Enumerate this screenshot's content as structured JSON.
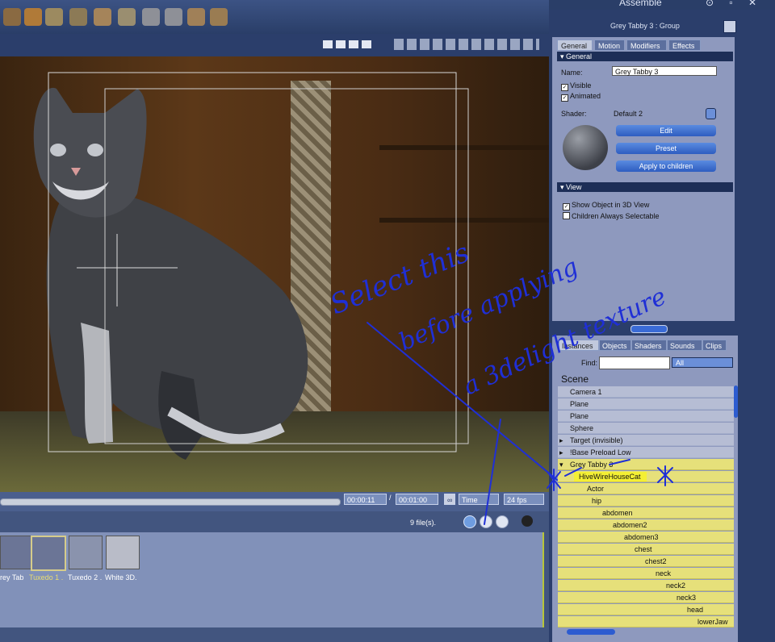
{
  "toolbar": {
    "mode_label": "Assemble",
    "window_controls": "⊙ ▫ ✕"
  },
  "viewport": {
    "subject": "cat figure"
  },
  "timeline": {
    "current_time": "00:00:11",
    "separator": "/",
    "total_time": "00:01:00",
    "time_mode": "Time",
    "fps": "24 fps"
  },
  "library": {
    "file_count": "9 file(s).",
    "items": [
      {
        "label": "rey Tab"
      },
      {
        "label": "Tuxedo 1 ."
      },
      {
        "label": "Tuxedo 2 ."
      },
      {
        "label": "White 3D."
      }
    ],
    "selected_color": "#d6cc8a"
  },
  "properties": {
    "title": "Grey Tabby 3 : Group",
    "tabs": [
      "General",
      "Motion",
      "Modifiers",
      "Effects"
    ],
    "general_header": "General",
    "name_label": "Name:",
    "name_value": "Grey Tabby 3",
    "visible_label": "Visible",
    "animated_label": "Animated",
    "shader_label": "Shader:",
    "shader_value": "Default 2",
    "edit_button": "Edit",
    "preset_button": "Preset",
    "apply_button": "Apply to children",
    "view_header": "View",
    "show_object_label": "Show Object in 3D View",
    "children_selectable_label": "Children Always Selectable"
  },
  "scene_panel": {
    "tabs": [
      "Instances",
      "Objects",
      "Shaders",
      "Sounds",
      "Clips"
    ],
    "find_label": "Find:",
    "filter_value": "All",
    "scene_header": "Scene",
    "rows": [
      {
        "label": "Camera 1"
      },
      {
        "label": "Plane"
      },
      {
        "label": "Plane"
      },
      {
        "label": "Sphere"
      },
      {
        "label": "Target (invisible)"
      },
      {
        "label": "!Base Preload Low"
      },
      {
        "label": "Grey Tabby 3"
      },
      {
        "label": "HiveWireHouseCat"
      },
      {
        "label": "Actor"
      },
      {
        "label": "hip"
      },
      {
        "label": "abdomen"
      },
      {
        "label": "abdomen2"
      },
      {
        "label": "abdomen3"
      },
      {
        "label": "chest"
      },
      {
        "label": "chest2"
      },
      {
        "label": "neck"
      },
      {
        "label": "neck2"
      },
      {
        "label": "neck3"
      },
      {
        "label": "head"
      },
      {
        "label": "lowerJaw"
      }
    ],
    "highlight_color": "#e6e07a",
    "selected_color": "#f4ef34"
  },
  "annotation": {
    "text_lines": [
      "Select this",
      "before applying",
      "a 3delight texture"
    ],
    "ink_color": "#1f2fd6"
  }
}
